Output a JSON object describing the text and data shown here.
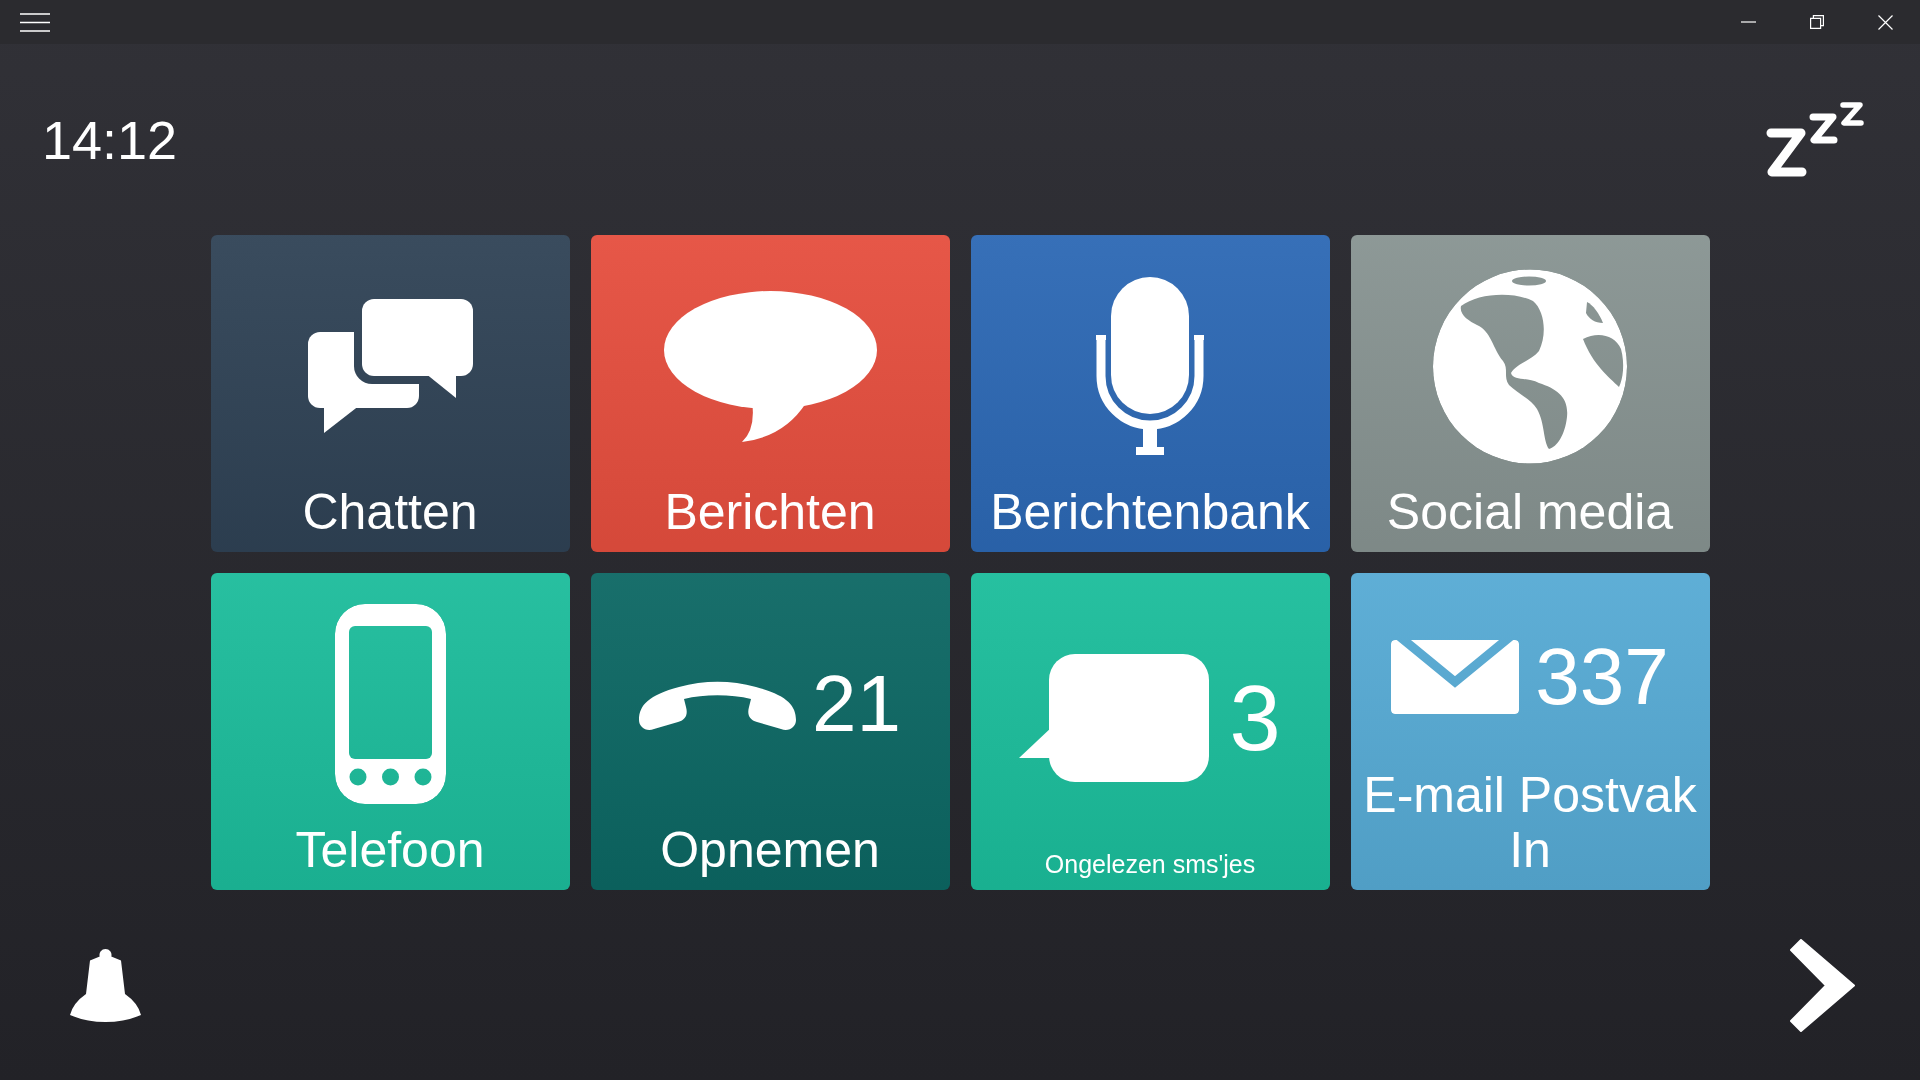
{
  "header": {
    "time": "14:12"
  },
  "tiles": [
    {
      "kind": "launcher",
      "label": "Chatten",
      "color": "#2f4255"
    },
    {
      "kind": "launcher",
      "label": "Berichten",
      "color": "#e54e3e"
    },
    {
      "kind": "launcher",
      "label": "Berichtenbank",
      "color": "#2c68b4"
    },
    {
      "kind": "launcher",
      "label": "Social media",
      "color": "#879391"
    },
    {
      "kind": "launcher",
      "label": "Telefoon",
      "color": "#1cbc9b"
    },
    {
      "kind": "counter",
      "label": "Opnemen",
      "count": "21",
      "color": "#0c6763"
    },
    {
      "kind": "notice",
      "label": "Ongelezen sms'jes",
      "count": "3",
      "color": "#1bbd9b"
    },
    {
      "kind": "counter",
      "label": "E-mail Postvak In",
      "count": "337",
      "color": "#56aad4"
    }
  ]
}
